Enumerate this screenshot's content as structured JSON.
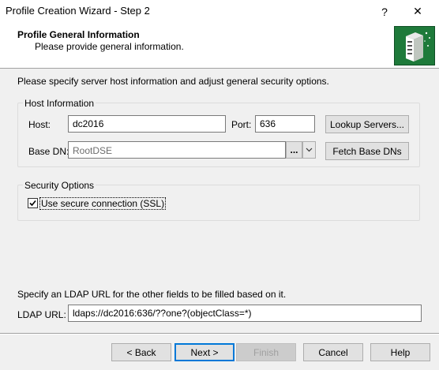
{
  "window": {
    "title": "Profile Creation Wizard - Step 2",
    "help_glyph": "?",
    "close_glyph": "✕"
  },
  "header": {
    "title": "Profile General Information",
    "subtitle": "Please provide general information."
  },
  "intro": "Please specify server host information and adjust general security options.",
  "host_info": {
    "group_label": "Host Information",
    "host_label": "Host:",
    "host_value": "dc2016",
    "port_label": "Port:",
    "port_value": "636",
    "lookup_button": "Lookup Servers...",
    "base_dn_label": "Base DN:",
    "base_dn_value": "RootDSE",
    "browse_button": "...",
    "fetch_button": "Fetch Base DNs"
  },
  "security": {
    "group_label": "Security Options",
    "ssl_label": "Use secure connection (SSL)",
    "ssl_checked": true
  },
  "ldap": {
    "instruction": "Specify an LDAP URL for the other fields to be filled based on it.",
    "label": "LDAP URL:",
    "value": "ldaps://dc2016:636/??one?(objectClass=*)"
  },
  "footer": {
    "back": "< Back",
    "next": "Next >",
    "finish": "Finish",
    "cancel": "Cancel",
    "help": "Help"
  },
  "colors": {
    "accent": "#0078d7",
    "logo_green": "#1e7a3a"
  }
}
